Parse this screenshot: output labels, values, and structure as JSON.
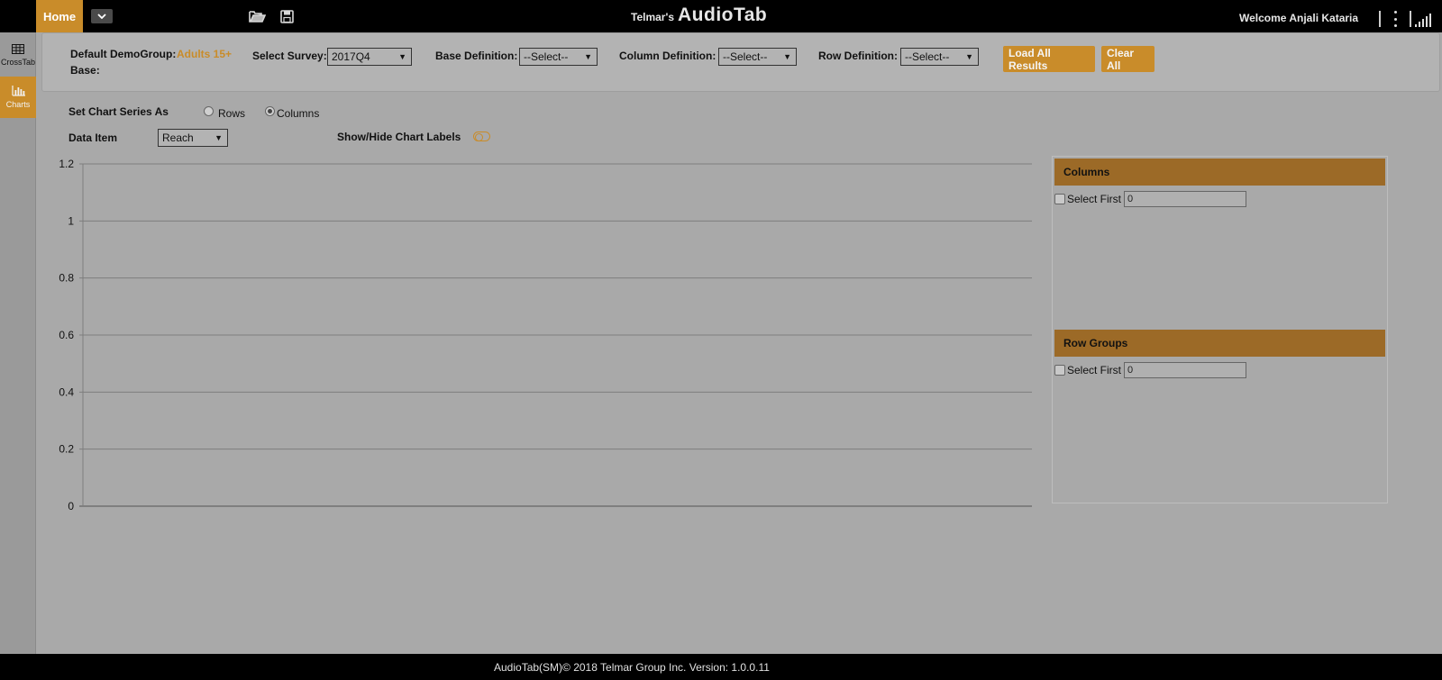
{
  "topbar": {
    "home_label": "Home",
    "dropdown_icon": "chevron-down-icon",
    "open_icon": "folder-open-icon",
    "save_icon": "save-icon",
    "title_small": "Telmar's",
    "title_large": "AudioTab",
    "welcome": "Welcome Anjali Kataria",
    "menu_icon": "kebab-menu-icon",
    "signal_icon": "signal-icon"
  },
  "sidebar": {
    "items": [
      {
        "label": "CrossTab",
        "icon": "table-icon",
        "active": false
      },
      {
        "label": "Charts",
        "icon": "bar-chart-icon",
        "active": true
      }
    ]
  },
  "filters": {
    "demogroup_label": "Default DemoGroup:",
    "demogroup_value": "Adults 15+",
    "base_label": "Base:",
    "survey_label": "Select Survey:",
    "survey_value": "2017Q4",
    "base_def_label": "Base Definition:",
    "base_def_value": "--Select--",
    "col_def_label": "Column Definition:",
    "col_def_value": "--Select--",
    "row_def_label": "Row Definition:",
    "row_def_value": "--Select--",
    "load_all": "Load All Results",
    "clear_all": "Clear All"
  },
  "controls": {
    "series_label": "Set Chart Series As",
    "rows_label": "Rows",
    "columns_label": "Columns",
    "selected_series": "Columns",
    "data_item_label": "Data Item",
    "data_item_value": "Reach",
    "labels_toggle": "Show/Hide Chart Labels"
  },
  "chart_data": {
    "type": "bar",
    "categories": [],
    "series": [],
    "ylim": [
      0,
      1.2
    ],
    "yticks": [
      "0",
      "0.2",
      "0.4",
      "0.6",
      "0.8",
      "1",
      "1.2"
    ],
    "grid": true
  },
  "right_panel": {
    "columns_header": "Columns",
    "columns_select_first": "Select First",
    "columns_count": "0",
    "rowgroups_header": "Row Groups",
    "rowgroups_select_first": "Select First",
    "rowgroups_count": "0"
  },
  "colors": {
    "accent": "#c98c2a",
    "panel_header": "#9c6a27",
    "background": "#a9a9a9"
  },
  "footer": {
    "text": "AudioTab(SM)© 2018 Telmar Group Inc. Version: 1.0.0.11"
  }
}
